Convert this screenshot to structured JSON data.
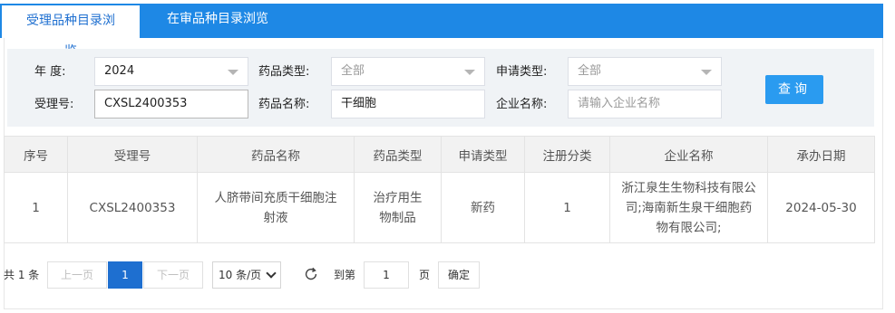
{
  "tabs": [
    {
      "label": "受理品种目录浏览",
      "active": true
    },
    {
      "label": "在审品种目录浏览",
      "active": false
    }
  ],
  "search": {
    "year_label": "年    度:",
    "year_value": "2024",
    "drug_type_label": "药品类型:",
    "drug_type_value": "全部",
    "apply_type_label": "申请类型:",
    "apply_type_value": "全部",
    "accept_no_label": "受理号:",
    "accept_no_value": "CXSL2400353",
    "drug_name_label": "药品名称:",
    "drug_name_value": "干细胞",
    "company_label": "企业名称:",
    "company_placeholder": "请输入企业名称",
    "query_button": "查询"
  },
  "table": {
    "headers": [
      "序号",
      "受理号",
      "药品名称",
      "药品类型",
      "申请类型",
      "注册分类",
      "企业名称",
      "承办日期"
    ],
    "rows": [
      [
        "1",
        "CXSL2400353",
        "人脐带间充质干细胞注射液",
        "治疗用生物制品",
        "新药",
        "1",
        "浙江泉生生物科技有限公司;海南新生泉干细胞药物有限公司;",
        "2024-05-30"
      ]
    ]
  },
  "pager": {
    "total_text": "共 1 条",
    "prev_label": "上一页",
    "current_page": "1",
    "next_label": "下一页",
    "page_size": "10 条/页",
    "goto_label": "到第",
    "goto_value": "1",
    "page_unit": "页",
    "confirm_label": "确定"
  },
  "colors": {
    "accent": "#1e88e5",
    "active_page": "#1e6fd0",
    "query_button": "#2a9bf0"
  }
}
